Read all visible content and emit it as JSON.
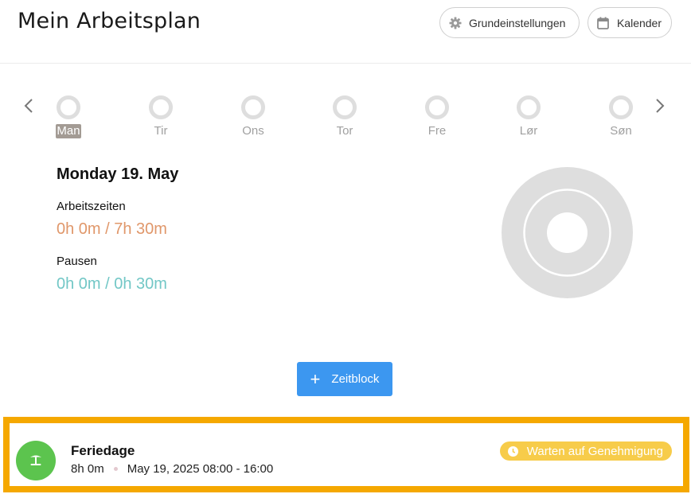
{
  "header": {
    "title": "Mein Arbeitsplan",
    "settings_label": "Grundeinstellungen",
    "settings_icon": "gear-icon",
    "calendar_label": "Kalender",
    "calendar_icon": "calendar-icon"
  },
  "week": {
    "days": [
      {
        "label": "Man",
        "active": true
      },
      {
        "label": "Tir",
        "active": false
      },
      {
        "label": "Ons",
        "active": false
      },
      {
        "label": "Tor",
        "active": false
      },
      {
        "label": "Fre",
        "active": false
      },
      {
        "label": "Lør",
        "active": false
      },
      {
        "label": "Søn",
        "active": false
      }
    ]
  },
  "summary": {
    "date": "Monday 19. May",
    "work_label": "Arbeitszeiten",
    "work_value": "0h 0m / 7h 30m",
    "pause_label": "Pausen",
    "pause_value": "0h 0m / 0h 30m"
  },
  "actions": {
    "add_label": "Zeitblock"
  },
  "entry": {
    "title": "Feriedage",
    "duration": "8h 0m",
    "range": "May 19, 2025 08:00 - 16:00",
    "status": "Warten auf Genehmigung",
    "icon": "palm-tree-icon"
  },
  "colors": {
    "work": "#e0976a",
    "pause": "#72c7c6",
    "accent": "#3c97f0",
    "vacation": "#5cc44e",
    "pending": "#f7cc4a",
    "highlight": "#f5a800"
  }
}
